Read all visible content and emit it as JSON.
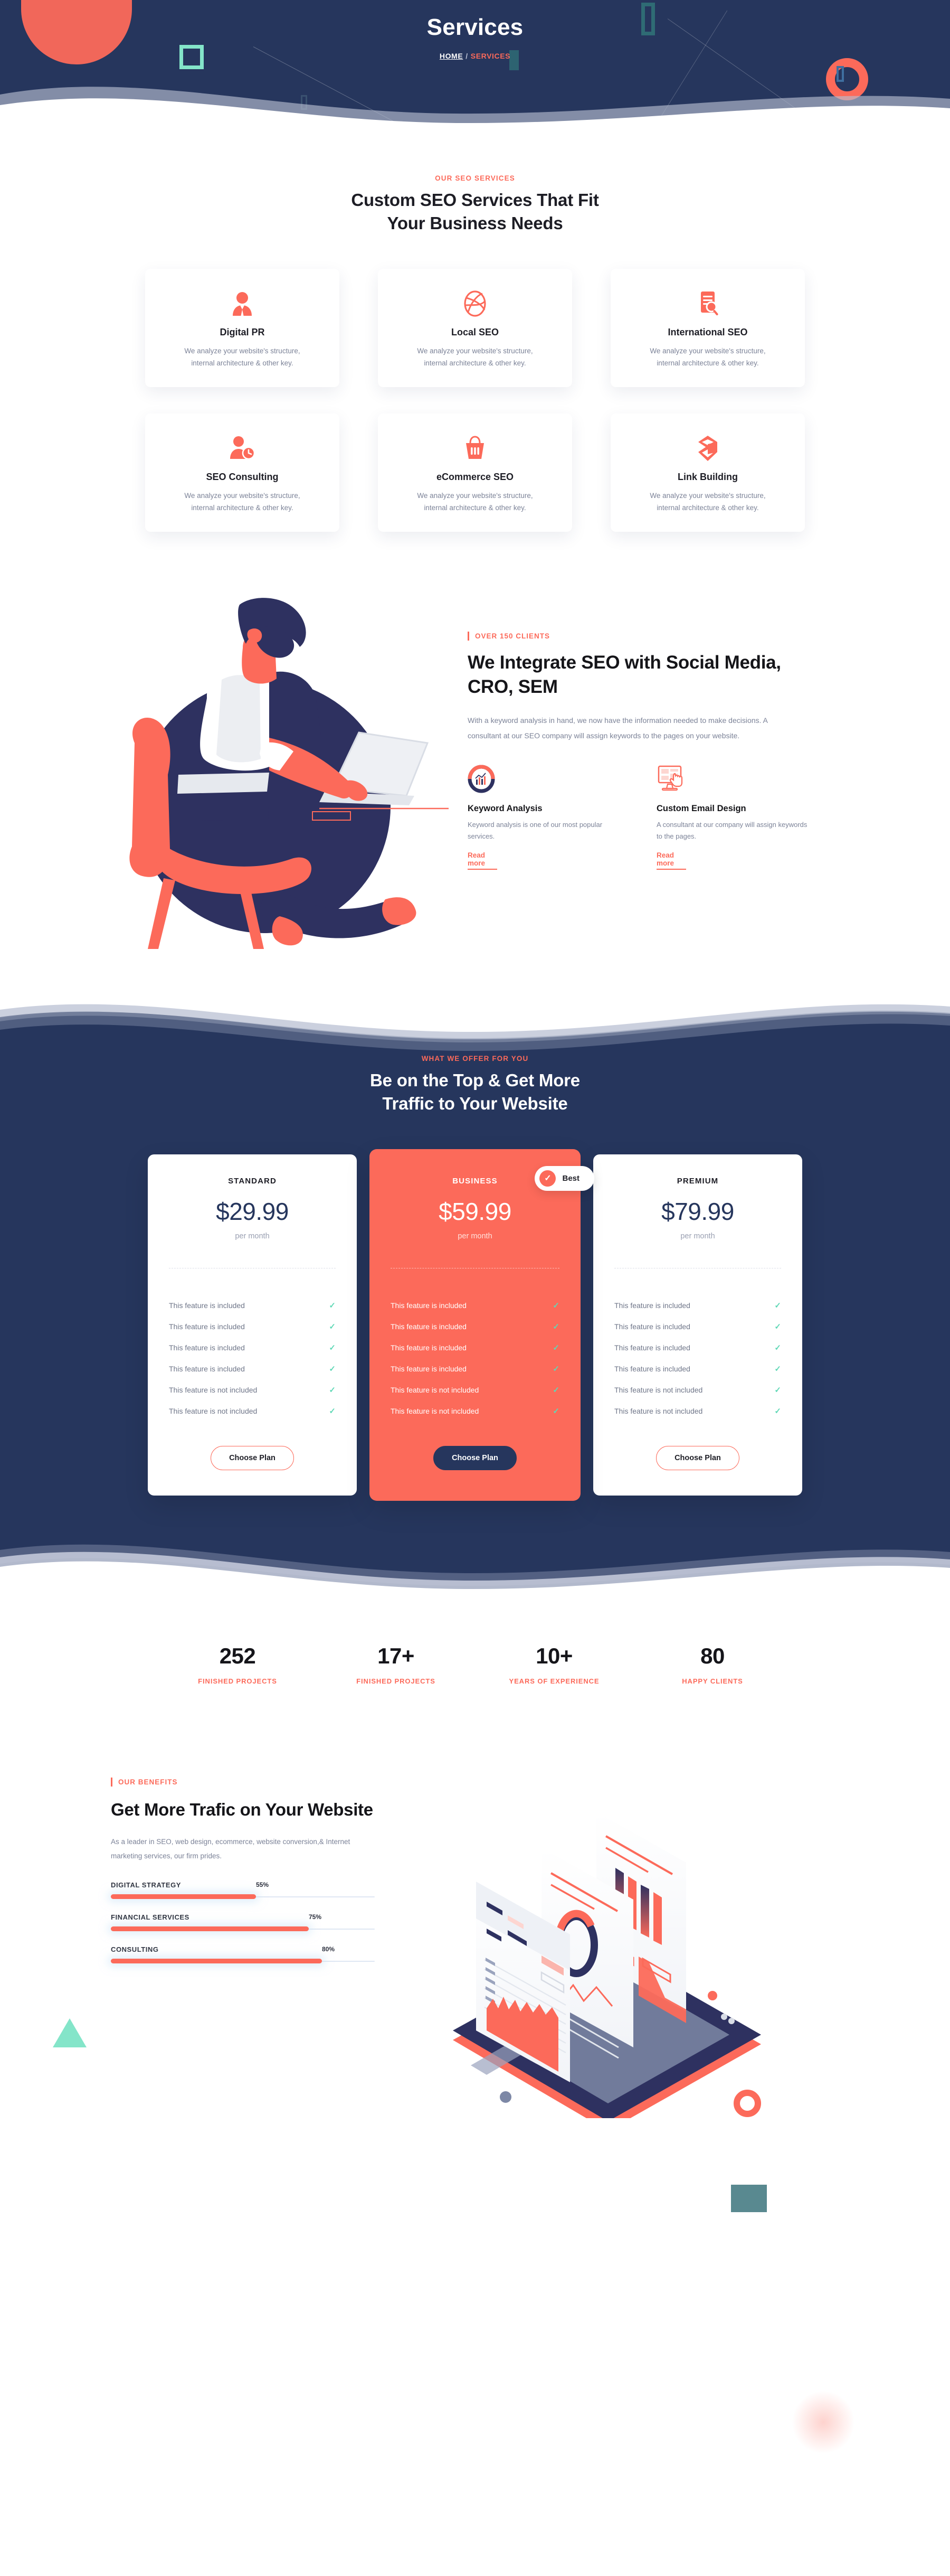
{
  "hero": {
    "title": "Services",
    "breadcrumb": {
      "home": "HOME",
      "separator": "/",
      "current": "SERVICES"
    }
  },
  "services_section": {
    "eyebrow": "OUR SEO SERVICES",
    "title_line1": "Custom SEO Services That Fit",
    "title_line2": "Your Business Needs",
    "cards": [
      {
        "icon": "businessman-icon",
        "title": "Digital PR",
        "desc_line1": "We analyze your website's structure,",
        "desc_line2": "internal architecture & other key."
      },
      {
        "icon": "dribbble-ball-icon",
        "title": "Local SEO",
        "desc_line1": "We analyze your website's structure,",
        "desc_line2": "internal architecture & other key."
      },
      {
        "icon": "document-search-icon",
        "title": "International SEO",
        "desc_line1": "We analyze your website's structure,",
        "desc_line2": "internal architecture & other key."
      },
      {
        "icon": "user-clock-icon",
        "title": "SEO Consulting",
        "desc_line1": "We analyze your website's structure,",
        "desc_line2": "internal architecture & other key."
      },
      {
        "icon": "shopping-basket-icon",
        "title": "eCommerce SEO",
        "desc_line1": "We analyze your website's structure,",
        "desc_line2": "internal architecture & other key."
      },
      {
        "icon": "link-chain-icon",
        "title": "Link Building",
        "desc_line1": "We analyze your website's structure,",
        "desc_line2": "internal architecture & other key."
      }
    ]
  },
  "integrate_section": {
    "label": "OVER 150 CLIENTS",
    "heading": "We Integrate SEO with Social Media, CRO, SEM",
    "paragraph": "With a keyword analysis in hand, we now have the information needed to make decisions. A consultant at our SEO company will assign keywords to the pages on your website.",
    "features": [
      {
        "icon": "donut-chart-icon",
        "title": "Keyword Analysis",
        "desc": "Keyword analysis is one of our most popular services.",
        "link": "Read more"
      },
      {
        "icon": "monitor-click-icon",
        "title": "Custom Email Design",
        "desc": "A consultant at our company will assign keywords to the pages.",
        "link": "Read more"
      }
    ]
  },
  "pricing_section": {
    "eyebrow": "WHAT WE OFFER FOR YOU",
    "title_line1": "Be on the Top & Get More",
    "title_line2": "Traffic to Your Website",
    "best_badge": {
      "check": "✓",
      "label": "Best"
    },
    "plans": [
      {
        "name": "STANDARD",
        "price": "$29.99",
        "period": "per month",
        "featured": false,
        "cta": "Choose Plan",
        "features": [
          "This feature is included",
          "This feature is included",
          "This feature is included",
          "This feature is included",
          "This feature is not included",
          "This feature is not included"
        ]
      },
      {
        "name": "BUSINESS",
        "price": "$59.99",
        "period": "per month",
        "featured": true,
        "cta": "Choose Plan",
        "features": [
          "This feature is included",
          "This feature is included",
          "This feature is included",
          "This feature is included",
          "This feature is not included",
          "This feature is not included"
        ]
      },
      {
        "name": "PREMIUM",
        "price": "$79.99",
        "period": "per month",
        "featured": false,
        "cta": "Choose Plan",
        "features": [
          "This feature is included",
          "This feature is included",
          "This feature is included",
          "This feature is included",
          "This feature is not included",
          "This feature is not included"
        ]
      }
    ],
    "check_glyph": "✓"
  },
  "stats_section": {
    "items": [
      {
        "value": "252",
        "label": "FINISHED PROJECTS"
      },
      {
        "value": "17+",
        "label": "FINISHED PROJECTS"
      },
      {
        "value": "10+",
        "label": "YEARS OF EXPERIENCE"
      },
      {
        "value": "80",
        "label": "HAPPY CLIENTS"
      }
    ]
  },
  "benefits_section": {
    "label": "OUR BENEFITS",
    "heading": "Get More Trafic on Your Website",
    "paragraph": "As a leader in SEO, web design, ecommerce, website conversion,& Internet marketing services, our firm prides.",
    "skills": [
      {
        "name": "DIGITAL STRATEGY",
        "percent": "55%",
        "value": 55
      },
      {
        "name": "FINANCIAL SERVICES",
        "percent": "75%",
        "value": 75
      },
      {
        "name": "CONSULTING",
        "percent": "80%",
        "value": 80
      }
    ]
  },
  "colors": {
    "accent": "#fc6a5a",
    "navy": "#26365d",
    "mint": "#84e5c9",
    "teal": "#2f6b74",
    "check_green": "#5fd8b6",
    "muted_text": "#7c8398"
  }
}
